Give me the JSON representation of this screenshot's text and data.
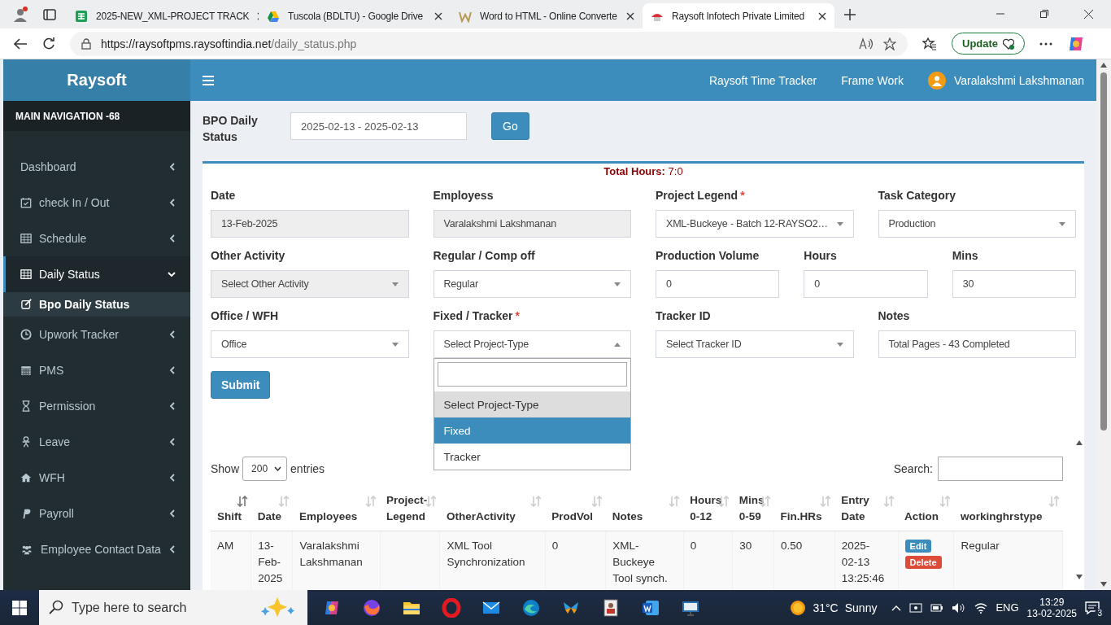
{
  "browser": {
    "tabs": [
      {
        "title": "2025-NEW_XML-PROJECT TRACK",
        "selected": false
      },
      {
        "title": "Tuscola (BDLTU) - Google Drive",
        "selected": false
      },
      {
        "title": "Word to HTML - Online Converte",
        "selected": false
      },
      {
        "title": "Raysoft Infotech Private Limited",
        "selected": true
      }
    ],
    "url_host": "https://raysoftpms.raysoftindia.net",
    "url_path": "/daily_status.php",
    "update_button": "Update"
  },
  "header": {
    "brand": "Raysoft",
    "links": [
      "Raysoft Time Tracker",
      "Frame Work"
    ],
    "user": "Varalakshmi Lakshmanan"
  },
  "sidebar": {
    "heading": "MAIN NAVIGATION -68",
    "items": [
      {
        "label": "Dashboard",
        "expanded": false,
        "selected": false
      },
      {
        "label": "check In / Out",
        "expanded": false,
        "selected": false
      },
      {
        "label": "Schedule",
        "expanded": false,
        "selected": false
      },
      {
        "label": "Daily Status",
        "expanded": true,
        "selected": true,
        "children": [
          {
            "label": "Bpo Daily Status",
            "selected": true
          }
        ]
      },
      {
        "label": "Upwork Tracker",
        "expanded": false,
        "selected": false
      },
      {
        "label": "PMS",
        "expanded": false,
        "selected": false
      },
      {
        "label": "Permission",
        "expanded": false,
        "selected": false
      },
      {
        "label": "Leave",
        "expanded": false,
        "selected": false
      },
      {
        "label": "WFH",
        "expanded": false,
        "selected": false
      },
      {
        "label": "Payroll",
        "expanded": false,
        "selected": false
      },
      {
        "label": "Employee Contact Data",
        "expanded": false,
        "selected": false
      }
    ]
  },
  "filter": {
    "title": "BPO Daily Status",
    "date_range": "2025-02-13 - 2025-02-13",
    "go_button": "Go"
  },
  "form": {
    "total_label": "Total Hours:",
    "total_value": "7:0",
    "fields": [
      {
        "label": "Date",
        "kind": "text",
        "value": "13-Feb-2025",
        "disabled": true
      },
      {
        "label": "Employess",
        "kind": "text",
        "value": "Varalakshmi Lakshmanan",
        "disabled": true
      },
      {
        "label": "Project Legend",
        "kind": "select",
        "value": "XML-Buckeye - Batch 12-RAYSO2…",
        "required_mark": "*",
        "disabled": false
      },
      {
        "label": "Task Category",
        "kind": "select",
        "value": "Production",
        "disabled": false
      },
      {
        "label": "Other Activity",
        "kind": "select",
        "value": "Select Other Activity",
        "disabled": true
      },
      {
        "label": "Regular / Comp off",
        "kind": "select",
        "value": "Regular",
        "disabled": false
      },
      {
        "label": "Production Volume",
        "kind": "number",
        "value": "0",
        "disabled": false
      },
      {
        "label": "Hours",
        "kind": "number",
        "value": "0",
        "disabled": false
      },
      {
        "label": "Mins",
        "kind": "number",
        "value": "30",
        "disabled": false
      },
      {
        "label": "Office / WFH",
        "kind": "select",
        "value": "Office",
        "disabled": false
      },
      {
        "label": "Fixed / Tracker",
        "kind": "select",
        "value": "Select Project-Type",
        "required_mark": "*",
        "disabled": false,
        "open": true,
        "options": [
          {
            "label": "Select Project-Type",
            "selected": true,
            "highlighted": false
          },
          {
            "label": "Fixed",
            "selected": false,
            "highlighted": true
          },
          {
            "label": "Tracker",
            "selected": false,
            "highlighted": false
          }
        ]
      },
      {
        "label": "Tracker ID",
        "kind": "select",
        "value": "Select Tracker ID",
        "disabled": false
      },
      {
        "label": "Notes",
        "kind": "text",
        "value": "Total Pages - 43 Completed",
        "disabled": false
      }
    ],
    "submit_button": "Submit"
  },
  "table": {
    "show_label": "Show",
    "entries_value": "200",
    "entries_label": "entries",
    "search_label": "Search:",
    "columns": [
      {
        "label": "Shift",
        "sorted": true
      },
      {
        "label": "Date",
        "sorted": false
      },
      {
        "label": "Employees",
        "sorted": false
      },
      {
        "label": "Project-\nLegend",
        "sorted": false
      },
      {
        "label": "OtherActivity",
        "sorted": false
      },
      {
        "label": "ProdVol",
        "sorted": false
      },
      {
        "label": "Notes",
        "sorted": false
      },
      {
        "label": "Hours\n0-12",
        "sorted": false
      },
      {
        "label": "Mins\n0-59",
        "sorted": false
      },
      {
        "label": "Fin.HRs",
        "sorted": false
      },
      {
        "label": "Entry\nDate",
        "sorted": false
      },
      {
        "label": "Action",
        "sorted": false
      },
      {
        "label": "workinghrstype",
        "sorted": false
      }
    ],
    "rows": [
      {
        "cells": [
          "AM",
          "13-\nFeb-\n2025",
          "Varalakshmi\nLakshmanan",
          "",
          "XML Tool\nSynchronization",
          "0",
          "XML-\nBuckeye\nTool synch.",
          "0",
          "30",
          "0.50",
          "2025-\n02-13\n13:25:46",
          null,
          "Regular"
        ],
        "actions": [
          "Edit",
          "Delete"
        ]
      }
    ]
  },
  "taskbar": {
    "search_placeholder": "Type here to search",
    "temperature": "31°C",
    "weather": "Sunny",
    "language": "ENG",
    "time": "13:29",
    "date": "13-02-2025",
    "notifications": "3"
  }
}
